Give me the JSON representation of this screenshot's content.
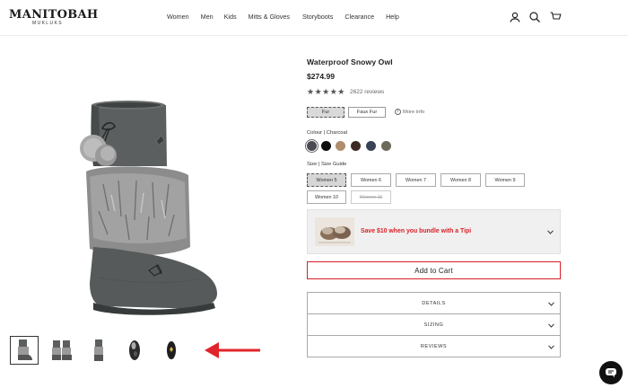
{
  "brand": {
    "name": "MANITOBAH",
    "sub": "MUKLUKS"
  },
  "nav": [
    "Women",
    "Men",
    "Kids",
    "Mitts & Gloves",
    "Storyboots",
    "Clearance",
    "Help"
  ],
  "header_icons": [
    "account-icon",
    "search-icon",
    "cart-icon"
  ],
  "product": {
    "title": "Waterproof Snowy Owl",
    "price": "$274.99",
    "rating_stars": "★★★★★",
    "rating": 5,
    "reviews": "2622 reviews"
  },
  "material": {
    "options": [
      "Fur",
      "Faux Fur"
    ],
    "selected": "Fur",
    "more_info": "More info"
  },
  "colour": {
    "label": "Colour | Charcoal",
    "swatches": [
      {
        "name": "Charcoal",
        "color": "#4a4a52"
      },
      {
        "name": "Black",
        "color": "#0d0d0d"
      },
      {
        "name": "Tan",
        "color": "#b08d6e"
      },
      {
        "name": "Brown",
        "color": "#3b2a22"
      },
      {
        "name": "Navy",
        "color": "#3a4257"
      },
      {
        "name": "Olive",
        "color": "#6e6a5a"
      }
    ],
    "selected": "Charcoal"
  },
  "size": {
    "label": "Size | Size Guide",
    "options": [
      "Women 5",
      "Women 6",
      "Women 7",
      "Women 8",
      "Women 9",
      "Women 10",
      "Women 11"
    ],
    "selected": "Women 5",
    "unavailable": [
      "Women 11"
    ]
  },
  "bundle": {
    "text": "Save $10 when you bundle with a Tipi"
  },
  "add_to_cart": "Add to Cart",
  "accordions": [
    "DETAILS",
    "SIZING",
    "REVIEWS"
  ],
  "thumbnails": [
    "thumb-front",
    "thumb-pair",
    "thumb-side",
    "thumb-sole",
    "thumb-top"
  ],
  "colors": {
    "accent_red": "#d81f26"
  }
}
